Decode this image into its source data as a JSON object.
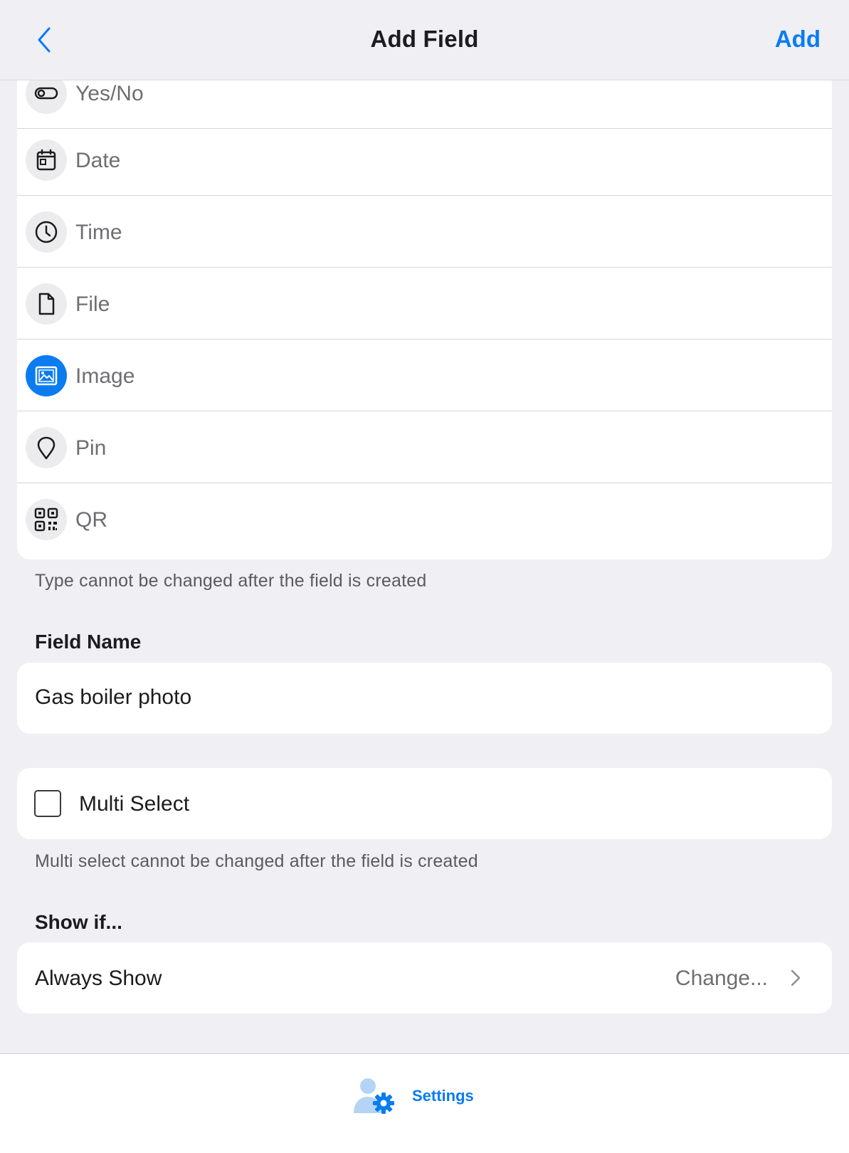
{
  "nav": {
    "title": "Add Field",
    "add_label": "Add"
  },
  "types": [
    {
      "label": "Yes/No",
      "icon": "toggle-icon",
      "selected": false
    },
    {
      "label": "Date",
      "icon": "calendar-icon",
      "selected": false
    },
    {
      "label": "Time",
      "icon": "clock-icon",
      "selected": false
    },
    {
      "label": "File",
      "icon": "file-icon",
      "selected": false
    },
    {
      "label": "Image",
      "icon": "image-icon",
      "selected": true
    },
    {
      "label": "Pin",
      "icon": "pin-icon",
      "selected": false
    },
    {
      "label": "QR",
      "icon": "qr-code-icon",
      "selected": false
    }
  ],
  "type_footnote": "Type cannot be changed after the field is created",
  "field_name": {
    "header": "Field Name",
    "value": "Gas boiler photo"
  },
  "multi_select": {
    "label": "Multi Select",
    "checked": false,
    "footnote": "Multi select cannot be changed after the field is created"
  },
  "show_if": {
    "header": "Show if...",
    "value": "Always Show",
    "change_label": "Change..."
  },
  "tabbar": {
    "settings_label": "Settings"
  },
  "colors": {
    "accent": "#0a7cf0",
    "background": "#efeff4"
  }
}
